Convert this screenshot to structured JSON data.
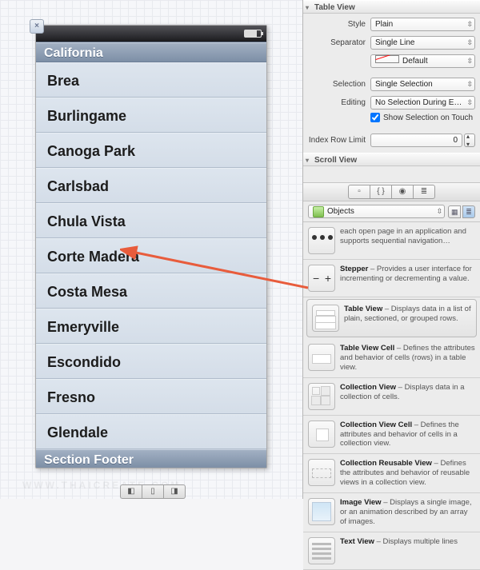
{
  "device": {
    "closeGlyph": "×",
    "sectionHeader": "California",
    "rows": [
      "Brea",
      "Burlingame",
      "Canoga Park",
      "Carlsbad",
      "Chula Vista",
      "Corte Madera",
      "Costa Mesa",
      "Emeryville",
      "Escondido",
      "Fresno",
      "Glendale"
    ],
    "sectionFooter": "Section Footer"
  },
  "inspector": {
    "tableView": {
      "title": "Table View",
      "style": {
        "label": "Style",
        "value": "Plain"
      },
      "separator": {
        "label": "Separator",
        "value": "Single Line"
      },
      "separatorDefault": "Default",
      "selection": {
        "label": "Selection",
        "value": "Single Selection"
      },
      "editing": {
        "label": "Editing",
        "value": "No Selection During E…"
      },
      "showSel": "Show Selection on Touch",
      "indexRow": {
        "label": "Index Row Limit",
        "value": "0"
      }
    },
    "scrollView": {
      "title": "Scroll View"
    }
  },
  "library": {
    "toolbar": {
      "t1": "▫",
      "t2": "{ }",
      "t3": "◉",
      "t4": "≣"
    },
    "filter": {
      "label": "Objects"
    },
    "items": [
      {
        "icon": "i-nav",
        "title": "",
        "desc": "each open page in an application and supports sequential navigation…"
      },
      {
        "icon": "i-stepper",
        "title": "Stepper",
        "desc": " – Provides a user interface for incrementing or decrementing a value."
      },
      {
        "icon": "i-table",
        "title": "Table View",
        "desc": " – Displays data in a list of plain, sectioned, or grouped rows.",
        "sel": true
      },
      {
        "icon": "i-cell",
        "title": "Table View Cell",
        "desc": " – Defines the attributes and behavior of cells (rows) in a table view."
      },
      {
        "icon": "i-cv",
        "title": "Collection View",
        "desc": " – Displays data in a collection of cells."
      },
      {
        "icon": "i-cvc",
        "title": "Collection View Cell",
        "desc": " – Defines the attributes and behavior of cells in a collection view."
      },
      {
        "icon": "i-crv",
        "title": "Collection Reusable View",
        "desc": " – Defines the attributes and behavior of reusable views in a collection view."
      },
      {
        "icon": "i-img",
        "title": "Image View",
        "desc": " – Displays a single image, or an animation described by an array of images."
      },
      {
        "icon": "i-text",
        "title": "Text View",
        "desc": " – Displays multiple lines"
      }
    ]
  }
}
